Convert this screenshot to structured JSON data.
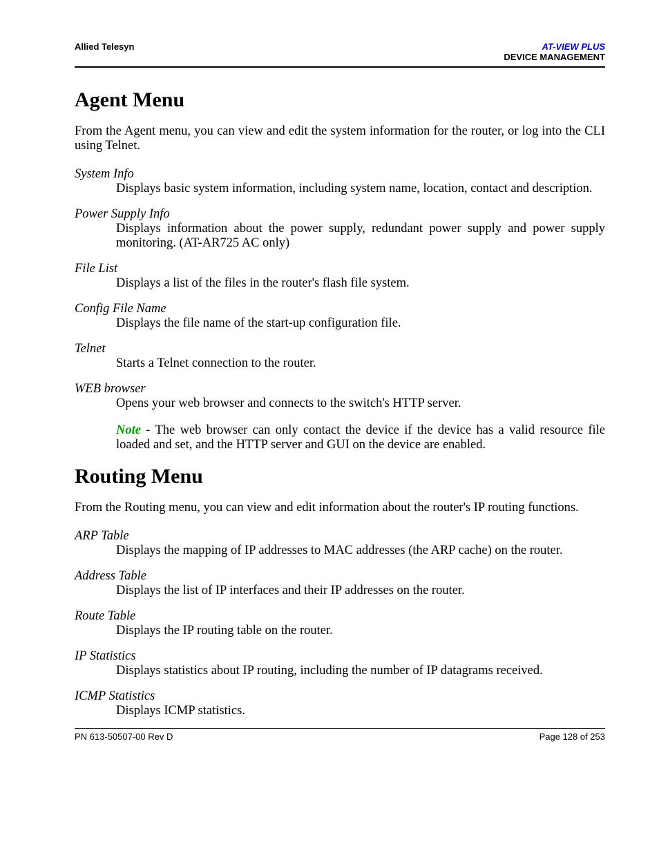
{
  "header": {
    "left": "Allied Telesyn",
    "right_line1": "AT-VIEW PLUS",
    "right_line2": "DEVICE MANAGEMENT"
  },
  "sections": [
    {
      "heading": "Agent Menu",
      "intro": "From the Agent menu, you can view and edit the system information for the router, or log into the CLI using Telnet.",
      "items": [
        {
          "title": "System Info",
          "desc": "Displays basic system information, including system name, location, contact and description."
        },
        {
          "title": "Power Supply Info",
          "desc": "Displays information about the power supply, redundant power supply and power supply monitoring. (AT-AR725 AC only)"
        },
        {
          "title": "File List",
          "desc": "Displays a list of the files in the router's flash file system."
        },
        {
          "title": "Config File Name",
          "desc": "Displays the file name of the start-up configuration file."
        },
        {
          "title": "Telnet",
          "desc": "Starts a Telnet connection to the router."
        },
        {
          "title": "WEB browser",
          "desc": "Opens your web browser and connects to the switch's HTTP server."
        }
      ],
      "note": {
        "label": "Note",
        "text": " - The web browser can only contact the device if the device has a valid resource file loaded and set, and the HTTP server and GUI on the device are enabled."
      }
    },
    {
      "heading": "Routing Menu",
      "intro": "From the Routing menu, you can view and edit information about the router's IP routing functions.",
      "items": [
        {
          "title": "ARP Table",
          "desc": "Displays the mapping of IP addresses to MAC addresses (the ARP cache) on the router."
        },
        {
          "title": "Address Table",
          "desc": "Displays the list of IP interfaces and their IP addresses on the router."
        },
        {
          "title": "Route Table",
          "desc": "Displays the IP routing table on the router."
        },
        {
          "title": "IP Statistics",
          "desc": "Displays statistics about IP routing, including the number of IP datagrams received."
        },
        {
          "title": "ICMP Statistics",
          "desc": "Displays ICMP statistics."
        }
      ]
    }
  ],
  "footer": {
    "left": "PN 613-50507-00 Rev D",
    "right": "Page 128 of 253"
  }
}
